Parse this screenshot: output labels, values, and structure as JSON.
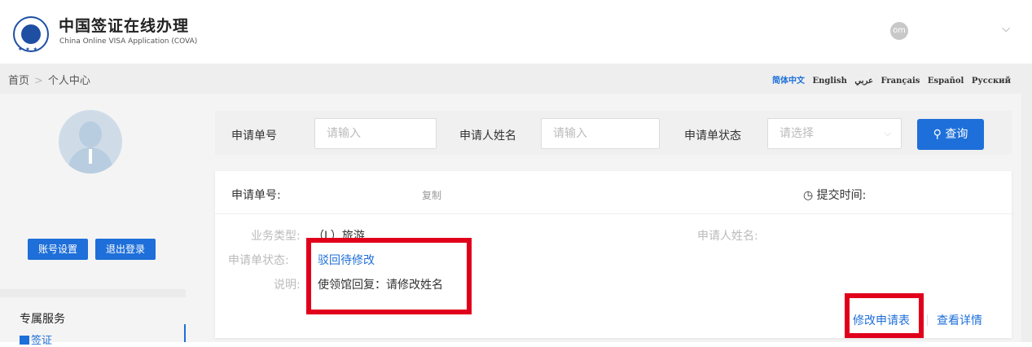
{
  "header": {
    "title": "中国签证在线办理",
    "subtitle": "China Online VISA Application  (COVA)",
    "user_initials": "om",
    "logo_name": "consular-seal-logo"
  },
  "breadcrumb": {
    "home": "首页",
    "separator": ">",
    "current": "个人中心"
  },
  "languages": [
    {
      "label": "简体中文",
      "active": true
    },
    {
      "label": "English",
      "active": false
    },
    {
      "label": "عربي",
      "active": false
    },
    {
      "label": "Français",
      "active": false
    },
    {
      "label": "Español",
      "active": false
    },
    {
      "label": "Русский",
      "active": false
    }
  ],
  "sidebar": {
    "account_settings": "账号设置",
    "logout": "退出登录",
    "section_title": "专属服务",
    "item_label": "签证"
  },
  "search": {
    "app_no_label": "申请单号",
    "app_no_placeholder": "请输入",
    "applicant_label": "申请人姓名",
    "applicant_placeholder": "请输入",
    "status_label": "申请单状态",
    "status_placeholder": "请选择",
    "button_label": "查询"
  },
  "card": {
    "app_no_label": "申请单号:",
    "copy_label": "复制",
    "submit_time_label": "提交时间:",
    "business_type_label": "业务类型:",
    "business_type_value": "（L）旅游",
    "applicant_name_label": "申请人姓名:",
    "status_label": "申请单状态:",
    "status_value": "驳回待修改",
    "note_label": "说明:",
    "note_value": "使领馆回复：请修改姓名",
    "edit_link": "修改申请表",
    "view_link": "查看详情"
  },
  "colors": {
    "accent": "#1e6fd9",
    "highlight_box": "#e0001b"
  }
}
